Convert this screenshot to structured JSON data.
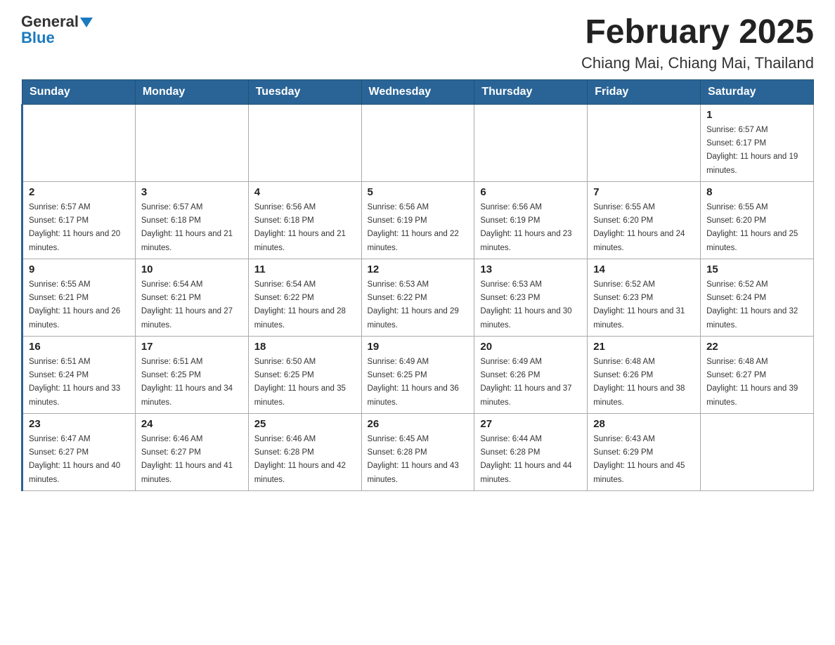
{
  "logo": {
    "general": "General",
    "blue": "Blue",
    "triangle_char": "▼"
  },
  "title": "February 2025",
  "subtitle": "Chiang Mai, Chiang Mai, Thailand",
  "days_header": [
    "Sunday",
    "Monday",
    "Tuesday",
    "Wednesday",
    "Thursday",
    "Friday",
    "Saturday"
  ],
  "weeks": [
    [
      {
        "day": "",
        "sunrise": "",
        "sunset": "",
        "daylight": ""
      },
      {
        "day": "",
        "sunrise": "",
        "sunset": "",
        "daylight": ""
      },
      {
        "day": "",
        "sunrise": "",
        "sunset": "",
        "daylight": ""
      },
      {
        "day": "",
        "sunrise": "",
        "sunset": "",
        "daylight": ""
      },
      {
        "day": "",
        "sunrise": "",
        "sunset": "",
        "daylight": ""
      },
      {
        "day": "",
        "sunrise": "",
        "sunset": "",
        "daylight": ""
      },
      {
        "day": "1",
        "sunrise": "Sunrise: 6:57 AM",
        "sunset": "Sunset: 6:17 PM",
        "daylight": "Daylight: 11 hours and 19 minutes."
      }
    ],
    [
      {
        "day": "2",
        "sunrise": "Sunrise: 6:57 AM",
        "sunset": "Sunset: 6:17 PM",
        "daylight": "Daylight: 11 hours and 20 minutes."
      },
      {
        "day": "3",
        "sunrise": "Sunrise: 6:57 AM",
        "sunset": "Sunset: 6:18 PM",
        "daylight": "Daylight: 11 hours and 21 minutes."
      },
      {
        "day": "4",
        "sunrise": "Sunrise: 6:56 AM",
        "sunset": "Sunset: 6:18 PM",
        "daylight": "Daylight: 11 hours and 21 minutes."
      },
      {
        "day": "5",
        "sunrise": "Sunrise: 6:56 AM",
        "sunset": "Sunset: 6:19 PM",
        "daylight": "Daylight: 11 hours and 22 minutes."
      },
      {
        "day": "6",
        "sunrise": "Sunrise: 6:56 AM",
        "sunset": "Sunset: 6:19 PM",
        "daylight": "Daylight: 11 hours and 23 minutes."
      },
      {
        "day": "7",
        "sunrise": "Sunrise: 6:55 AM",
        "sunset": "Sunset: 6:20 PM",
        "daylight": "Daylight: 11 hours and 24 minutes."
      },
      {
        "day": "8",
        "sunrise": "Sunrise: 6:55 AM",
        "sunset": "Sunset: 6:20 PM",
        "daylight": "Daylight: 11 hours and 25 minutes."
      }
    ],
    [
      {
        "day": "9",
        "sunrise": "Sunrise: 6:55 AM",
        "sunset": "Sunset: 6:21 PM",
        "daylight": "Daylight: 11 hours and 26 minutes."
      },
      {
        "day": "10",
        "sunrise": "Sunrise: 6:54 AM",
        "sunset": "Sunset: 6:21 PM",
        "daylight": "Daylight: 11 hours and 27 minutes."
      },
      {
        "day": "11",
        "sunrise": "Sunrise: 6:54 AM",
        "sunset": "Sunset: 6:22 PM",
        "daylight": "Daylight: 11 hours and 28 minutes."
      },
      {
        "day": "12",
        "sunrise": "Sunrise: 6:53 AM",
        "sunset": "Sunset: 6:22 PM",
        "daylight": "Daylight: 11 hours and 29 minutes."
      },
      {
        "day": "13",
        "sunrise": "Sunrise: 6:53 AM",
        "sunset": "Sunset: 6:23 PM",
        "daylight": "Daylight: 11 hours and 30 minutes."
      },
      {
        "day": "14",
        "sunrise": "Sunrise: 6:52 AM",
        "sunset": "Sunset: 6:23 PM",
        "daylight": "Daylight: 11 hours and 31 minutes."
      },
      {
        "day": "15",
        "sunrise": "Sunrise: 6:52 AM",
        "sunset": "Sunset: 6:24 PM",
        "daylight": "Daylight: 11 hours and 32 minutes."
      }
    ],
    [
      {
        "day": "16",
        "sunrise": "Sunrise: 6:51 AM",
        "sunset": "Sunset: 6:24 PM",
        "daylight": "Daylight: 11 hours and 33 minutes."
      },
      {
        "day": "17",
        "sunrise": "Sunrise: 6:51 AM",
        "sunset": "Sunset: 6:25 PM",
        "daylight": "Daylight: 11 hours and 34 minutes."
      },
      {
        "day": "18",
        "sunrise": "Sunrise: 6:50 AM",
        "sunset": "Sunset: 6:25 PM",
        "daylight": "Daylight: 11 hours and 35 minutes."
      },
      {
        "day": "19",
        "sunrise": "Sunrise: 6:49 AM",
        "sunset": "Sunset: 6:25 PM",
        "daylight": "Daylight: 11 hours and 36 minutes."
      },
      {
        "day": "20",
        "sunrise": "Sunrise: 6:49 AM",
        "sunset": "Sunset: 6:26 PM",
        "daylight": "Daylight: 11 hours and 37 minutes."
      },
      {
        "day": "21",
        "sunrise": "Sunrise: 6:48 AM",
        "sunset": "Sunset: 6:26 PM",
        "daylight": "Daylight: 11 hours and 38 minutes."
      },
      {
        "day": "22",
        "sunrise": "Sunrise: 6:48 AM",
        "sunset": "Sunset: 6:27 PM",
        "daylight": "Daylight: 11 hours and 39 minutes."
      }
    ],
    [
      {
        "day": "23",
        "sunrise": "Sunrise: 6:47 AM",
        "sunset": "Sunset: 6:27 PM",
        "daylight": "Daylight: 11 hours and 40 minutes."
      },
      {
        "day": "24",
        "sunrise": "Sunrise: 6:46 AM",
        "sunset": "Sunset: 6:27 PM",
        "daylight": "Daylight: 11 hours and 41 minutes."
      },
      {
        "day": "25",
        "sunrise": "Sunrise: 6:46 AM",
        "sunset": "Sunset: 6:28 PM",
        "daylight": "Daylight: 11 hours and 42 minutes."
      },
      {
        "day": "26",
        "sunrise": "Sunrise: 6:45 AM",
        "sunset": "Sunset: 6:28 PM",
        "daylight": "Daylight: 11 hours and 43 minutes."
      },
      {
        "day": "27",
        "sunrise": "Sunrise: 6:44 AM",
        "sunset": "Sunset: 6:28 PM",
        "daylight": "Daylight: 11 hours and 44 minutes."
      },
      {
        "day": "28",
        "sunrise": "Sunrise: 6:43 AM",
        "sunset": "Sunset: 6:29 PM",
        "daylight": "Daylight: 11 hours and 45 minutes."
      },
      {
        "day": "",
        "sunrise": "",
        "sunset": "",
        "daylight": ""
      }
    ]
  ]
}
